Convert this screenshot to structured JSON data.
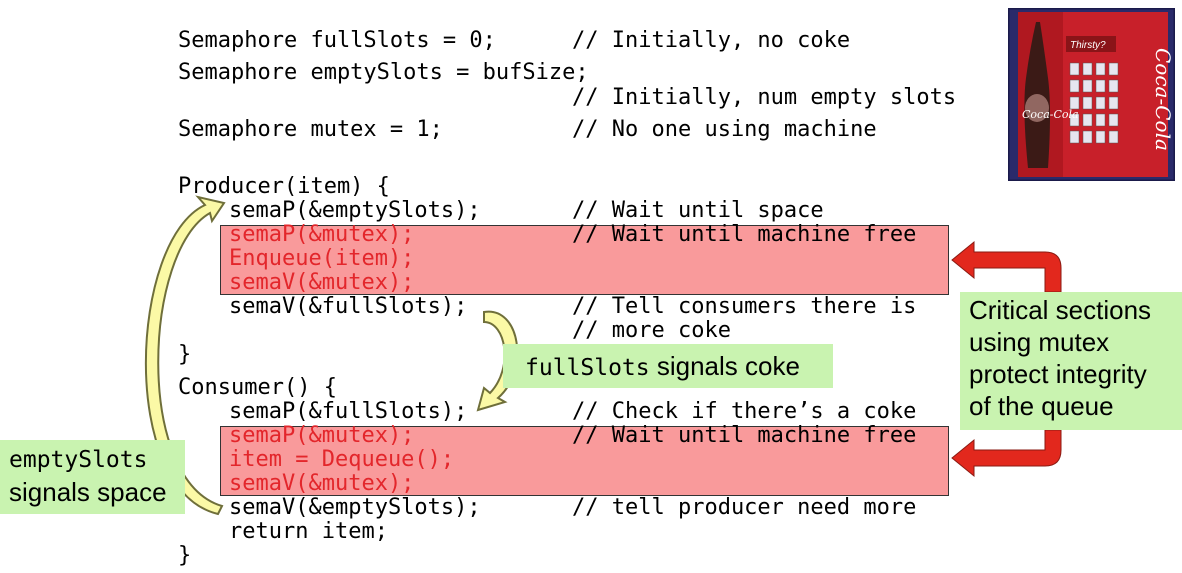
{
  "decl": [
    {
      "code": "Semaphore fullSlots = 0;",
      "comment": "// Initially, no coke"
    },
    {
      "code": "Semaphore emptySlots = bufSize;",
      "comment": ""
    },
    {
      "code": "",
      "comment": "// Initially, num empty slots"
    },
    {
      "code": "Semaphore mutex = 1;",
      "comment": "// No one using machine"
    }
  ],
  "producer": {
    "header": "Producer(item) {",
    "lines": [
      {
        "code": "semaP(&emptySlots);",
        "comment": "// Wait until space",
        "critical": false
      },
      {
        "code": "semaP(&mutex);",
        "comment": "// Wait until machine free",
        "critical": true
      },
      {
        "code": "Enqueue(item);",
        "comment": "",
        "critical": true
      },
      {
        "code": "semaV(&mutex);",
        "comment": "",
        "critical": true
      },
      {
        "code": "semaV(&fullSlots);",
        "comment": "// Tell consumers there is",
        "critical": false
      },
      {
        "code": "",
        "comment": "// more coke",
        "critical": false
      }
    ],
    "close": "}"
  },
  "consumer": {
    "header": "Consumer() {",
    "lines": [
      {
        "code": "semaP(&fullSlots);",
        "comment": "// Check if there’s a coke",
        "critical": false
      },
      {
        "code": "semaP(&mutex);",
        "comment": "// Wait until machine free",
        "critical": true
      },
      {
        "code": "item = Dequeue();",
        "comment": "",
        "critical": true
      },
      {
        "code": "semaV(&mutex);",
        "comment": "",
        "critical": true
      },
      {
        "code": "semaV(&emptySlots);",
        "comment": "// tell producer need more",
        "critical": false
      },
      {
        "code": "return item;",
        "comment": "",
        "critical": false
      }
    ],
    "close": "}"
  },
  "notes": {
    "full_slots_code": "fullSlots",
    "full_slots_text": " signals coke",
    "empty_slots_code": "emptySlots",
    "empty_slots_text": "signals space",
    "critical": [
      "Critical sections",
      "using mutex",
      "protect integrity",
      "of the queue"
    ]
  },
  "image": {
    "sign_text": "Thirsty?",
    "brand_text": "Coca-Cola"
  },
  "colors": {
    "critical_fill": "#f99a9b",
    "critical_text": "#e3262b",
    "note_fill": "#c9f3b0",
    "arrow_yellow": "#fbf9a6",
    "arrow_red": "#e2281d"
  }
}
